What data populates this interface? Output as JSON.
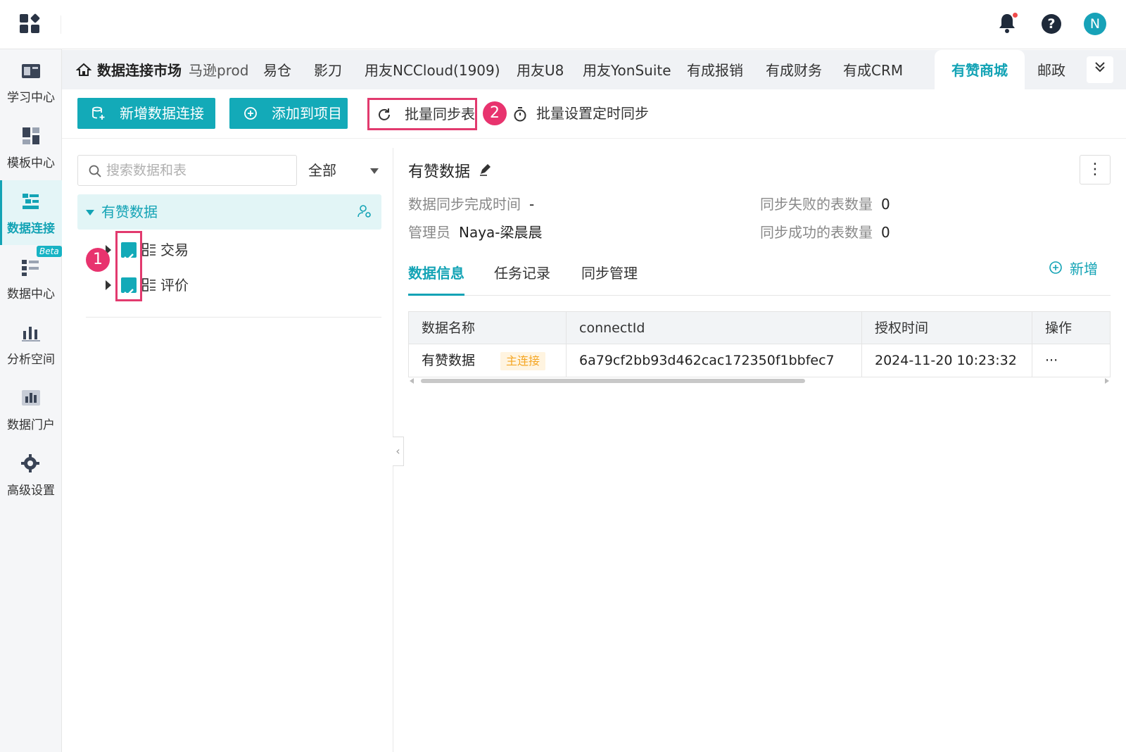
{
  "sidebar": {
    "items": [
      {
        "label": "学习中心",
        "icon": "book-icon"
      },
      {
        "label": "模板中心",
        "icon": "template-icon"
      },
      {
        "label": "数据连接",
        "icon": "data-connection-icon",
        "active": true
      },
      {
        "label": "数据中心",
        "icon": "data-center-icon",
        "badge": "Beta"
      },
      {
        "label": "分析空间",
        "icon": "analysis-icon"
      },
      {
        "label": "数据门户",
        "icon": "portal-icon"
      },
      {
        "label": "高级设置",
        "icon": "gear-icon"
      }
    ]
  },
  "header": {
    "avatar_initial": "N",
    "help_label": "?"
  },
  "tabs": {
    "home": "数据连接市场",
    "items": [
      "马逊prod",
      "易仓",
      "影刀",
      "用友NCCloud(1909)",
      "用友U8",
      "用友YonSuite",
      "有成报销",
      "有成财务",
      "有成CRM",
      "有赞商城",
      "邮政"
    ],
    "active": "有赞商城",
    "more": "»"
  },
  "toolbar": {
    "add_connection": "新增数据连接",
    "add_to_project": "添加到项目",
    "batch_sync": "批量同步表",
    "batch_timer": "批量设置定时同步",
    "step1": "1",
    "step2": "2"
  },
  "tree": {
    "search_placeholder": "搜索数据和表",
    "filter": "全部",
    "root": "有赞数据",
    "children": [
      {
        "name": "交易",
        "checked": true
      },
      {
        "name": "评价",
        "checked": true
      }
    ]
  },
  "detail": {
    "title": "有赞数据",
    "sync_time_label": "数据同步完成时间",
    "sync_time_value": "-",
    "admin_label": "管理员",
    "admin_value": "Naya-梁晨晨",
    "fail_label": "同步失败的表数量",
    "fail_value": "0",
    "success_label": "同步成功的表数量",
    "success_value": "0",
    "tabs": [
      "数据信息",
      "任务记录",
      "同步管理"
    ],
    "active_tab": "数据信息",
    "add_label": "新增",
    "kebab": "⋮"
  },
  "table": {
    "headers": [
      "数据名称",
      "connectId",
      "授权时间",
      "操作"
    ],
    "rows": [
      {
        "name": "有赞数据",
        "tag": "主连接",
        "connect_id": "6a79cf2bb93d462cac172350f1bbfec7",
        "auth_time": "2024-11-20 10:23:32",
        "action": "···"
      }
    ]
  },
  "colors": {
    "accent": "#13aab8",
    "highlight": "#e23a6e",
    "tag_bg": "#fff4e0",
    "tag_fg": "#f5a623"
  }
}
